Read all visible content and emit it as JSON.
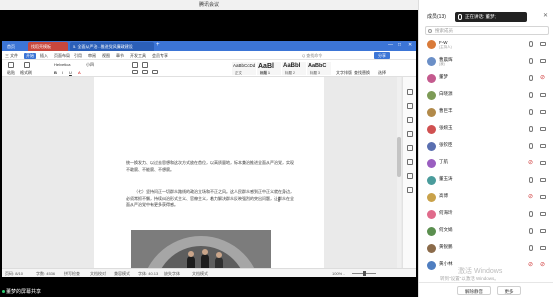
{
  "meeting": {
    "title": "腾讯会议"
  },
  "wps": {
    "tabs": {
      "home": "首页",
      "t1": "找稻壳模板",
      "t2": "5. 全面从严治...推进党风廉政建设",
      "add": "+"
    },
    "window_controls": [
      "—",
      "□",
      "✕"
    ],
    "menu": [
      "三 文件",
      "开始",
      "插入",
      "页面布局",
      "引用",
      "审阅",
      "视图",
      "章节",
      "开发工具",
      "会员专享"
    ],
    "menu_active_index": 1,
    "search_text": "Q 查找命令",
    "share_label": "分享",
    "ribbon": {
      "paste": "粘贴",
      "format_painter": "格式刷",
      "font": "Helvetica",
      "size": "小四",
      "styles": [
        {
          "sample": "AaBbCcDd",
          "name": "正文"
        },
        {
          "sample": "AaBl",
          "name": "标题 1"
        },
        {
          "sample": "AaBbI",
          "name": "标题 2"
        },
        {
          "sample": "AaBbC",
          "name": "标题 3"
        }
      ],
      "text_tools": "文字排版",
      "find_replace": "查找替换",
      "select": "选择"
    },
    "document": {
      "para1": "统一换发力、以过去思想和这次方式放在首位，以高质量地，标本兼治推进全面从严治党，实现不敢腐、不能腐、不想腐。",
      "para2": "（七）坚持问正一切群众路线的政治立场和不正之风。这人民群众感到正中正义就在身边，必须常抓不懈，持续纠治形式主义、官僚主义，着力解决群众反映强烈的突出问题，让群众在全面从严治党中有更多获得感。"
    },
    "status": [
      "页码: 8/10",
      "字数: 4536",
      "拼写检查",
      "文档校对",
      "兼容模式",
      "字体: 40.13",
      "缺失字体",
      "文档模式",
      "100% -"
    ]
  },
  "sharer": {
    "label": "董梦的屏幕共享"
  },
  "watermark": {
    "line1": "激活 Windows",
    "line2": "转到\"设置\"以激活 Windows。"
  },
  "panel": {
    "title": "成员(13)",
    "speaking": "正在讲话: 董梦;",
    "close": "✕",
    "search_placeholder": "搜索成员",
    "members": [
      {
        "name": "F-W",
        "sub": "(主持人)",
        "color": "#d97b3a",
        "muted": false,
        "cam_off": false
      },
      {
        "name": "曹晨辉",
        "sub": "(我)",
        "color": "#6b8fc7",
        "muted": false,
        "cam_off": false
      },
      {
        "name": "董梦",
        "sub": "",
        "color": "#c45a8e",
        "muted": false,
        "cam_off": true
      },
      {
        "name": "白晓源",
        "sub": "",
        "color": "#7d9b56",
        "muted": false,
        "cam_off": false
      },
      {
        "name": "曹巨丰",
        "sub": "",
        "color": "#b28a4a",
        "muted": false,
        "cam_off": false
      },
      {
        "name": "张婉玉",
        "sub": "",
        "color": "#d05151",
        "muted": false,
        "cam_off": false
      },
      {
        "name": "张钦臣",
        "sub": "",
        "color": "#5a6fb0",
        "muted": false,
        "cam_off": false
      },
      {
        "name": "丁航",
        "sub": "",
        "color": "#9a5ec0",
        "muted": true,
        "cam_off": false
      },
      {
        "name": "董玉涛",
        "sub": "",
        "color": "#4a9c9c",
        "muted": false,
        "cam_off": false
      },
      {
        "name": "高博",
        "sub": "",
        "color": "#c9a24a",
        "muted": true,
        "cam_off": false
      },
      {
        "name": "何海玲",
        "sub": "",
        "color": "#e06b8b",
        "muted": false,
        "cam_off": false
      },
      {
        "name": "何文娟",
        "sub": "",
        "color": "#5b8f4f",
        "muted": false,
        "cam_off": false
      },
      {
        "name": "黄锐鹏",
        "sub": "",
        "color": "#8b6b4a",
        "muted": false,
        "cam_off": false
      },
      {
        "name": "黄小林",
        "sub": "",
        "color": "#4f7ec0",
        "muted": true,
        "cam_off": true
      }
    ],
    "footer": {
      "mute_all": "解除静音",
      "more": "更多"
    }
  }
}
